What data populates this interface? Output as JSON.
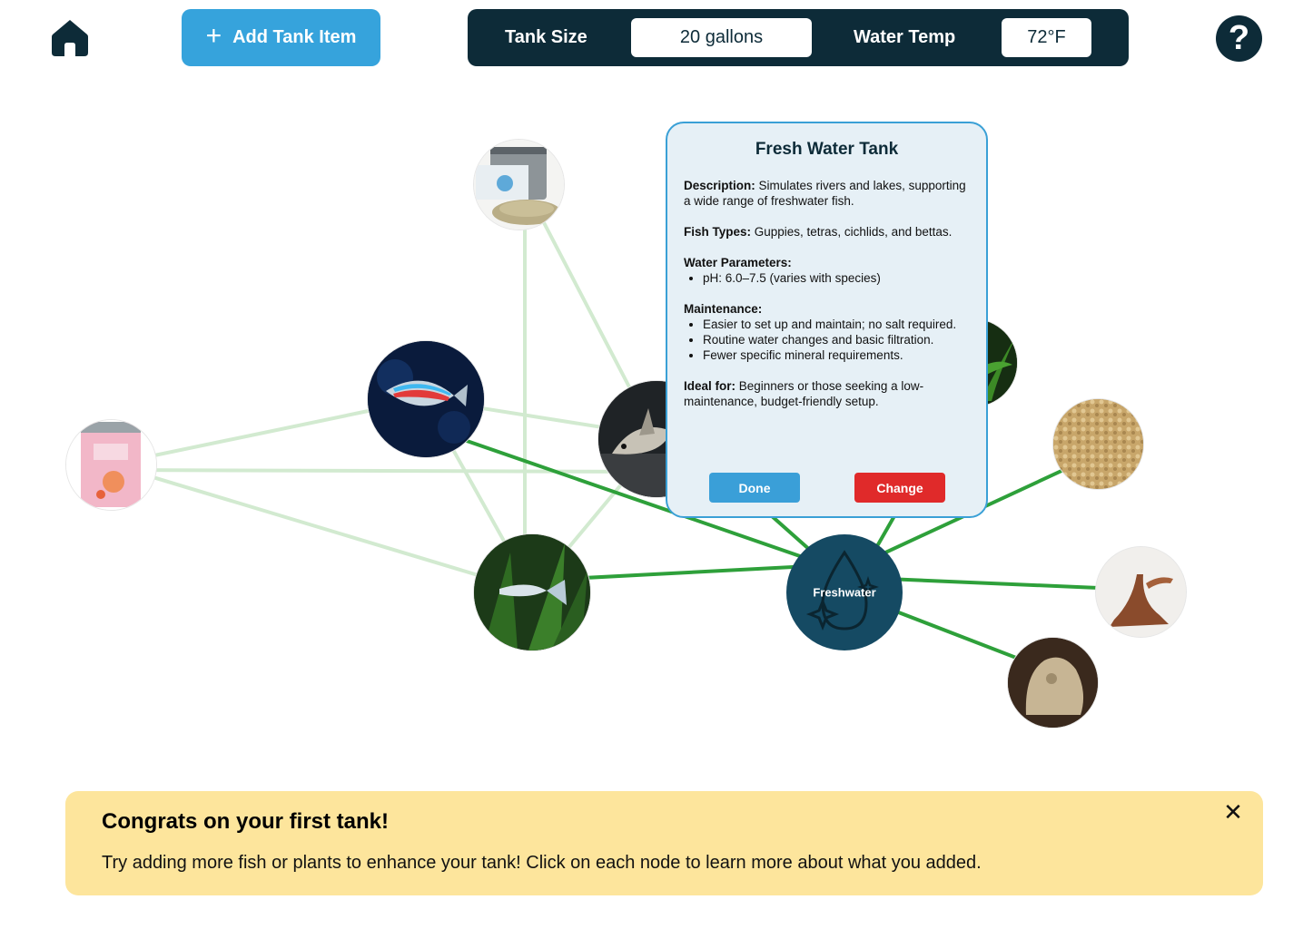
{
  "header": {
    "add_button_label": "Add Tank Item",
    "tank_size_label": "Tank Size",
    "tank_size_value": "20 gallons",
    "water_temp_label": "Water Temp",
    "water_temp_value": "72°F",
    "help_label": "?"
  },
  "graph": {
    "center_node_label": "Freshwater",
    "colors": {
      "strong_edge": "#2ea03a",
      "faint_edge": "#cfe9cc",
      "center_node": "#154a63"
    },
    "nodes": [
      {
        "id": "sinking-pellets",
        "name": "sinking-pellets-node"
      },
      {
        "id": "neon-tetra",
        "name": "neon-tetra-node"
      },
      {
        "id": "bloodworms",
        "name": "bloodworms-food-node"
      },
      {
        "id": "pleco",
        "name": "pleco-catfish-node"
      },
      {
        "id": "guppy",
        "name": "guppy-node"
      },
      {
        "id": "plant",
        "name": "aquatic-plant-node"
      },
      {
        "id": "gravel",
        "name": "gravel-substrate-node"
      },
      {
        "id": "driftwood",
        "name": "driftwood-node"
      },
      {
        "id": "rock",
        "name": "rock-decor-node"
      },
      {
        "id": "freshwater",
        "name": "freshwater-center-node"
      }
    ]
  },
  "card": {
    "title": "Fresh Water Tank",
    "description_label": "Description:",
    "description_text": " Simulates rivers and lakes, supporting a wide range of freshwater fish.",
    "fish_types_label": "Fish Types:",
    "fish_types_text": " Guppies, tetras, cichlids, and bettas.",
    "water_params_label": "Water Parameters:",
    "water_params": [
      "pH: 6.0–7.5 (varies with species)"
    ],
    "maintenance_label": "Maintenance:",
    "maintenance": [
      "Easier to set up and maintain; no salt required.",
      "Routine water changes and basic filtration.",
      "Fewer specific mineral requirements."
    ],
    "ideal_for_label": "Ideal for:",
    "ideal_for_text": " Beginners or those seeking a low-maintenance, budget-friendly setup.",
    "done_label": "Done",
    "change_label": "Change",
    "done_color": "#3a9fd8",
    "change_color": "#e02a2a"
  },
  "banner": {
    "title": "Congrats on your first tank!",
    "message": "Try adding more fish or plants to enhance your tank! Click on each node to learn more about what you added.",
    "close_label": "✕"
  }
}
